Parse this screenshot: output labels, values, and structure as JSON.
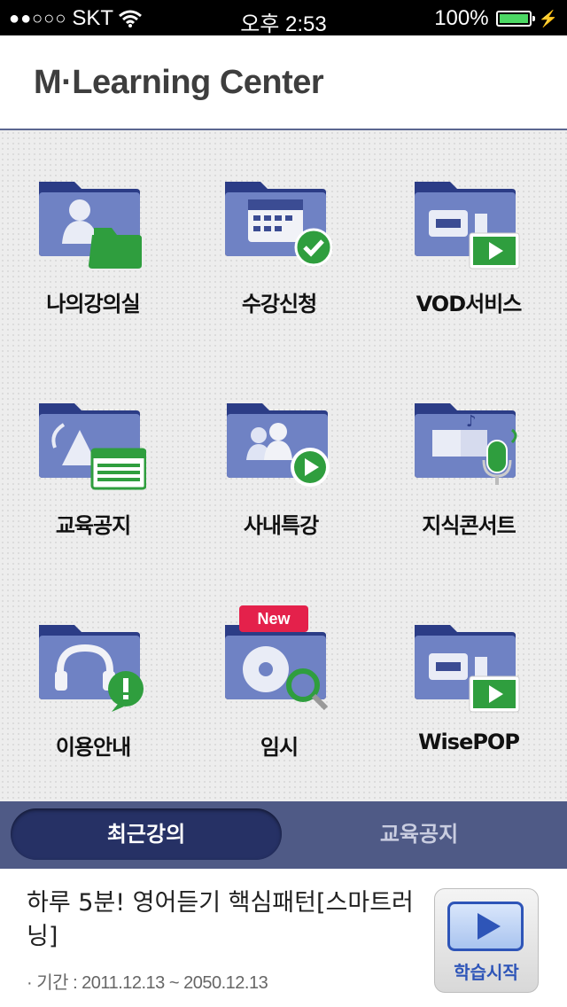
{
  "status": {
    "carrier": "SKT",
    "signal_dots": "●●○○○",
    "time": "오후 2:53",
    "battery": "100%"
  },
  "header": {
    "logo": "M·Learning Center"
  },
  "menu": [
    {
      "label": "나의강의실",
      "icon": "my-classroom-icon"
    },
    {
      "label": "수강신청",
      "icon": "enrollment-calendar-icon"
    },
    {
      "label": "VOD서비스",
      "icon": "vod-service-icon"
    },
    {
      "label": "교육공지",
      "icon": "education-notice-icon"
    },
    {
      "label": "사내특강",
      "icon": "company-lecture-icon"
    },
    {
      "label": "지식콘서트",
      "icon": "knowledge-concert-icon"
    },
    {
      "label": "이용안내",
      "icon": "usage-guide-icon"
    },
    {
      "label": "임시",
      "icon": "temp-disc-search-icon",
      "badge": "New"
    },
    {
      "label": "WisePOP",
      "icon": "wisepop-icon"
    }
  ],
  "tabs": {
    "recent": "최근강의",
    "notice": "교육공지"
  },
  "course": {
    "title": "하루 5분! 영어듣기 핵심패턴[스마트러닝]",
    "period": "· 기간 : 2011.12.13 ~ 2050.12.13",
    "start_label": "학습시작"
  },
  "colors": {
    "accent": "#4f5a86",
    "active_tab": "#263165",
    "new_badge": "#e4214b",
    "play": "#2e55b8"
  }
}
